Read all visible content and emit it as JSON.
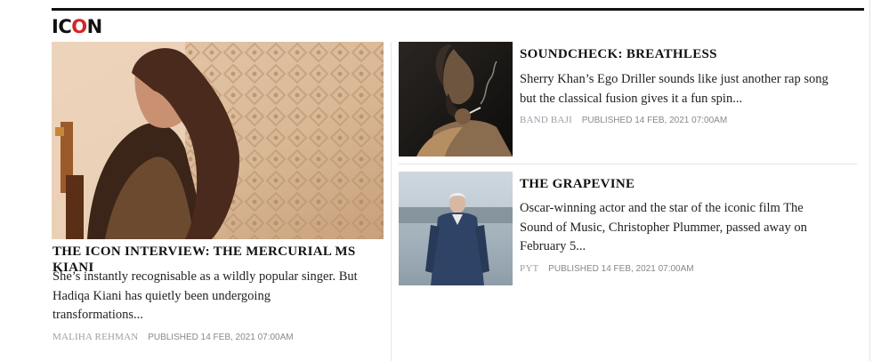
{
  "section": {
    "logo_part1": "IC",
    "logo_part2": "O",
    "logo_part3": "N",
    "accent_color": "#d4252a"
  },
  "stories": [
    {
      "headline": "THE ICON INTERVIEW: THE MERCURIAL MS KIANI",
      "excerpt_lines": [
        "She’s instantly recognisable as a wildly popular singer. But",
        "Hadiqa Kiani has quietly been undergoing",
        "transformations..."
      ],
      "author": "MALIHA REHMAN",
      "published": "PUBLISHED 14 FEB, 2021 07:00AM"
    },
    {
      "headline": "SOUNDCHECK: BREATHLESS",
      "excerpt_lines": [
        "Sherry Khan’s Ego Driller sounds like just another rap song",
        "but the classical fusion gives it a fun spin..."
      ],
      "author": "BAND BAJI",
      "published": "PUBLISHED 14 FEB, 2021 07:00AM"
    },
    {
      "headline": "THE GRAPEVINE",
      "excerpt_lines": [
        "Oscar-winning actor and the star of the iconic film The",
        "Sound of Music, Christopher Plummer, passed away on",
        "February 5..."
      ],
      "author": "PYT",
      "published": "PUBLISHED 14 FEB, 2021 07:00AM"
    }
  ]
}
